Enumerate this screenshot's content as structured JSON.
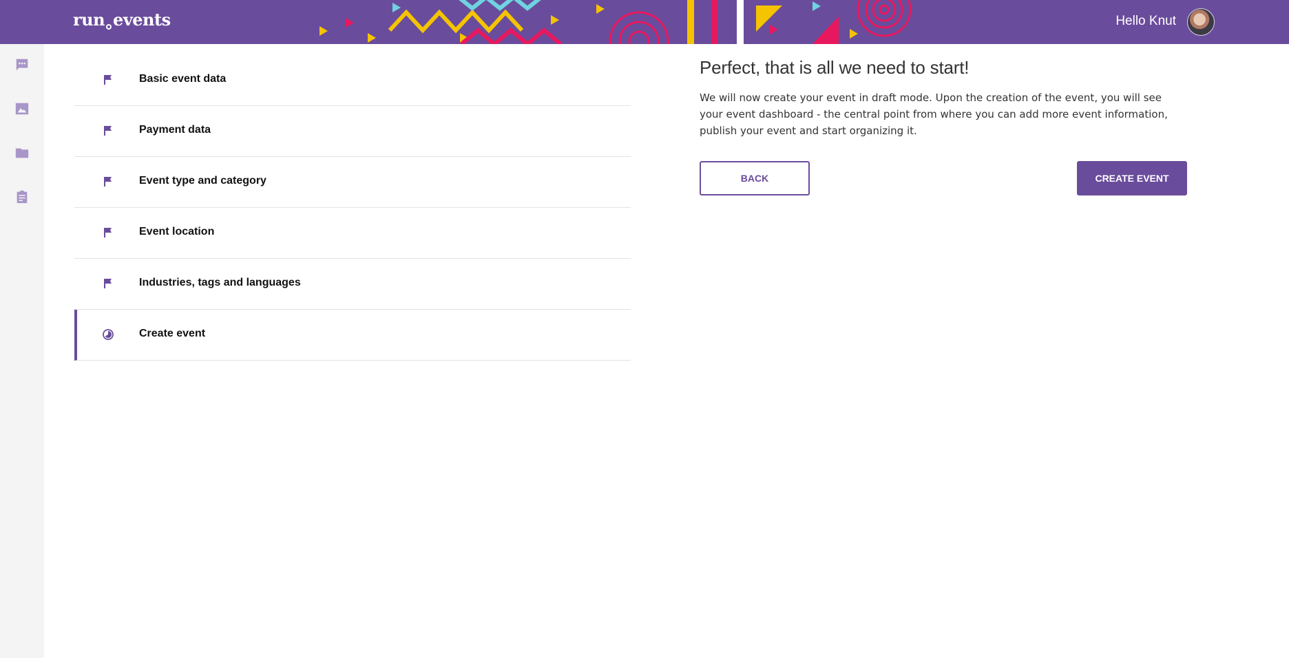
{
  "brand": {
    "left": "run",
    "right": "events"
  },
  "header": {
    "greeting": "Hello Knut"
  },
  "rail": {
    "items": [
      {
        "icon": "chat-icon"
      },
      {
        "icon": "image-icon"
      },
      {
        "icon": "folder-icon"
      },
      {
        "icon": "clipboard-icon"
      }
    ]
  },
  "steps": [
    {
      "label": "Basic event data",
      "icon": "flag-icon",
      "state": "done"
    },
    {
      "label": "Payment data",
      "icon": "flag-icon",
      "state": "done"
    },
    {
      "label": "Event type and category",
      "icon": "flag-icon",
      "state": "done"
    },
    {
      "label": "Event location",
      "icon": "flag-icon",
      "state": "done"
    },
    {
      "label": "Industries, tags and languages",
      "icon": "flag-icon",
      "state": "done"
    },
    {
      "label": "Create event",
      "icon": "progress-icon",
      "state": "active"
    }
  ],
  "panel": {
    "title": "Perfect, that is all we need to start!",
    "text": "We will now create your event in draft mode. Upon the creation of the event, you will see your event dashboard - the central point from where you can add more event information, publish your event and start organizing it.",
    "back_label": "BACK",
    "create_label": "CREATE EVENT"
  },
  "colors": {
    "brand": "#6a4c9c",
    "rail_bg": "#f4f4f4",
    "rail_icon": "#a996c8",
    "deco_yellow": "#f5c400",
    "deco_pink": "#e8185e",
    "deco_cyan": "#6fd3e0"
  }
}
